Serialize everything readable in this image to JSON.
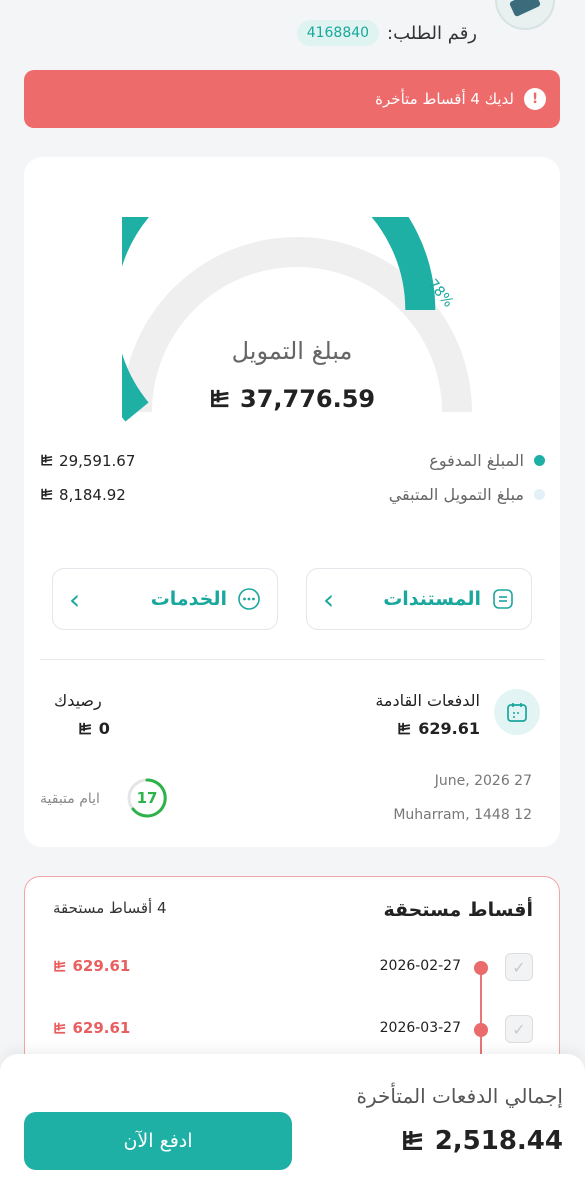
{
  "header": {
    "order_label": "رقم الطلب:",
    "order_number": "4168840"
  },
  "alert": {
    "text": "لديك 4 أقساط متأخرة",
    "icon": "alert-circle-icon",
    "color": "#ee6b6b"
  },
  "financing": {
    "progress_percent": 78,
    "progress_label": "78%",
    "title": "مبلغ التمويل",
    "amount": "37,776.59",
    "paid_label": "المبلغ المدفوع",
    "paid_amount": "29,591.67",
    "remaining_label": "مبلغ التمويل المتبقي",
    "remaining_amount": "8,184.92",
    "accent_color": "#1fb0a5"
  },
  "actions": {
    "documents_label": "المستندات",
    "services_label": "الخدمات"
  },
  "upcoming": {
    "label": "الدفعات القادمة",
    "amount": "629.61",
    "balance_label": "رصيدك",
    "balance_amount": "0",
    "date_gregorian": "June, 2026 27",
    "date_hijri": "Muharram, 1448 12",
    "days_remaining": "17",
    "days_label": "ايام متبقية"
  },
  "due": {
    "title": "أقساط مستحقة",
    "count_label": "4 أقساط مستحقة",
    "installments": [
      {
        "date": "2026-02-27",
        "amount": "629.61"
      },
      {
        "date": "2026-03-27",
        "amount": "629.61"
      }
    ]
  },
  "footer": {
    "late_label": "إجمالي الدفعات المتأخرة",
    "late_amount": "2,518.44",
    "pay_label": "ادفع الآن"
  }
}
